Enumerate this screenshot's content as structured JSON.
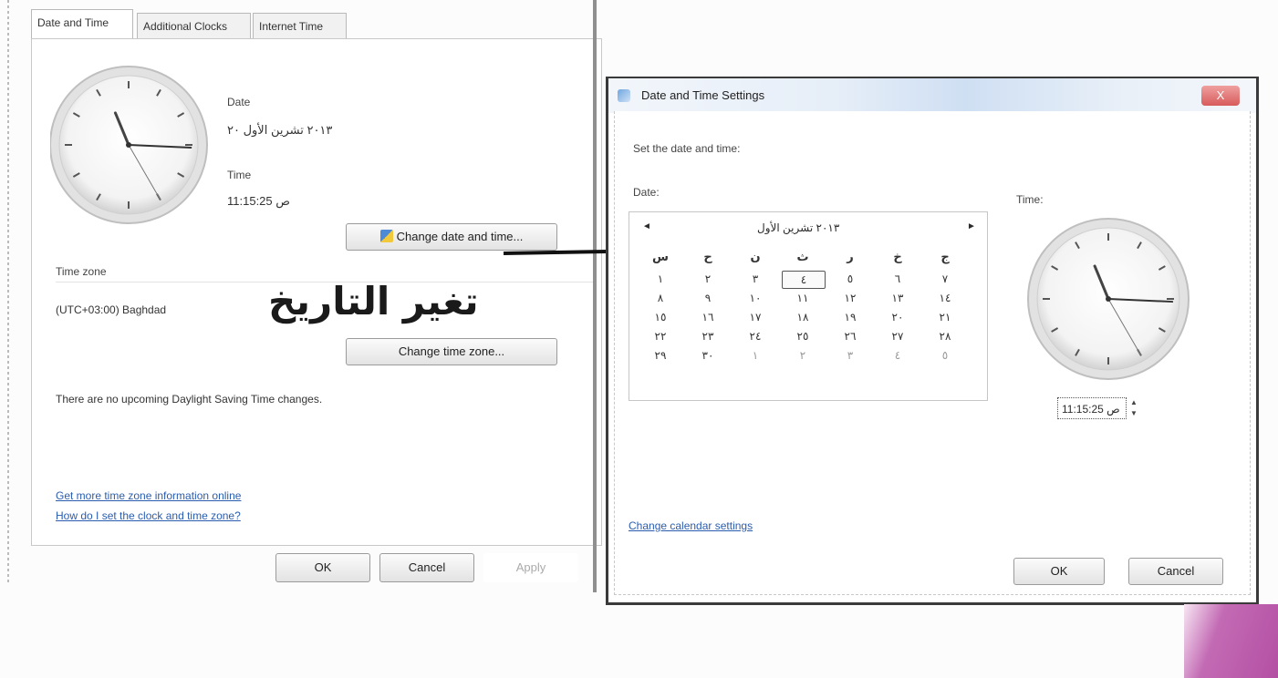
{
  "left_dialog": {
    "tabs": [
      {
        "label": "Date and Time"
      },
      {
        "label": "Additional Clocks"
      },
      {
        "label": "Internet Time"
      }
    ],
    "date_label": "Date",
    "date_value": "٢٠١٣ تشرين الأول ٢٠",
    "time_label": "Time",
    "time_value": "11:15:25 ص",
    "change_datetime_button": "Change date and time...",
    "time_zone_label": "Time zone",
    "time_zone_value": "(UTC+03:00) Baghdad",
    "change_timezone_button": "Change time zone...",
    "dst_note": "There are no upcoming Daylight Saving Time changes.",
    "link_more_info": "Get more time zone information online",
    "link_how_set": "How do I set the clock and time zone?",
    "ok_button": "OK",
    "cancel_button": "Cancel",
    "apply_button": "Apply"
  },
  "annotation": {
    "caption": "تغير التاريخ"
  },
  "right_dialog": {
    "title": "Date and Time Settings",
    "close_label": "X",
    "prompt": "Set the date and time:",
    "date_label": "Date:",
    "time_label": "Time:",
    "calendar": {
      "prev_label": "◄",
      "next_label": "►",
      "month_label": "٢٠١٣ تشرين الأول",
      "weekday_headers": [
        "س",
        "ح",
        "ن",
        "ث",
        "ر",
        "خ",
        "ج"
      ],
      "weeks": [
        [
          "١",
          "٢",
          "٣",
          "٤",
          "٥",
          "٦",
          "٧"
        ],
        [
          "٨",
          "٩",
          "١٠",
          "١١",
          "١٢",
          "١٣",
          "١٤"
        ],
        [
          "١٥",
          "١٦",
          "١٧",
          "١٨",
          "١٩",
          "٢٠",
          "٢١"
        ],
        [
          "٢٢",
          "٢٣",
          "٢٤",
          "٢٥",
          "٢٦",
          "٢٧",
          "٢٨"
        ],
        [
          "٢٩",
          "٣٠",
          "١",
          "٢",
          "٣",
          "٤",
          "٥"
        ]
      ],
      "selected_day": "٤"
    },
    "time_value": "11:15:25 ص",
    "change_calendar_link": "Change calendar settings",
    "ok_button": "OK",
    "cancel_button": "Cancel"
  },
  "clocks": {
    "hour": 11,
    "minute": 15,
    "second": 25
  }
}
